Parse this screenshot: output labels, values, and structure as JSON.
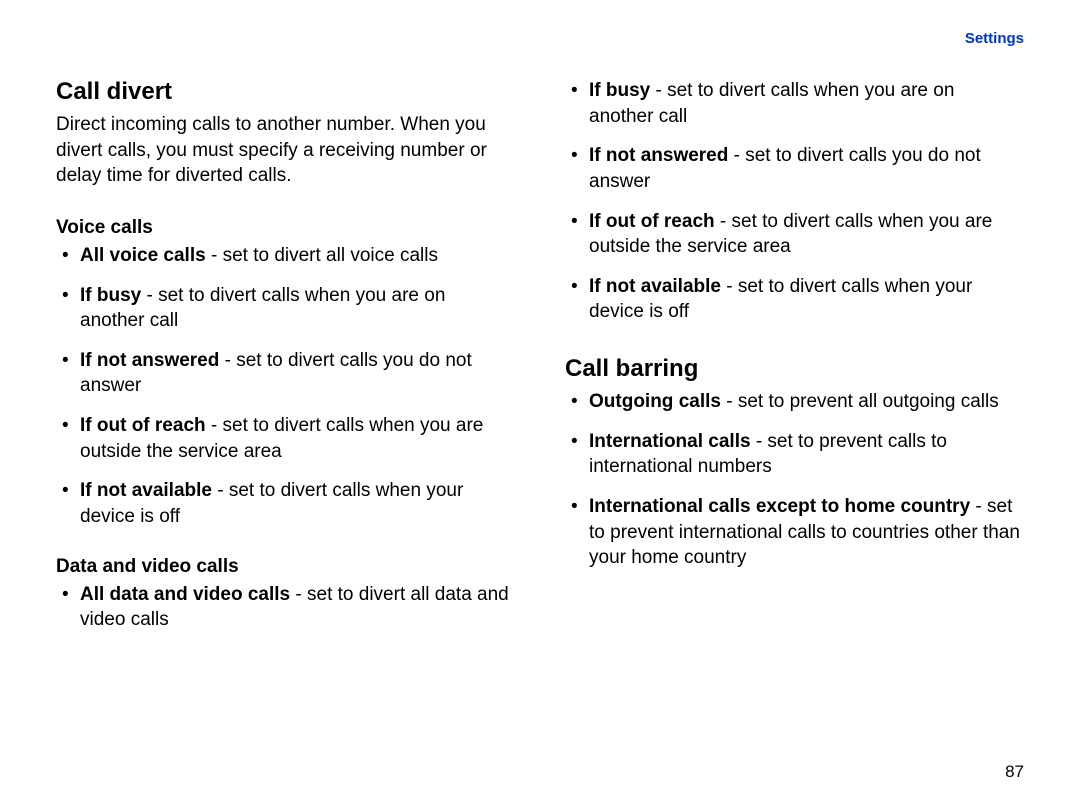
{
  "header_link": "Settings",
  "page_number": "87",
  "left": {
    "h_call_divert": "Call divert",
    "intro": "Direct incoming calls to another number. When you divert calls, you must specify a receiving number or delay time for diverted calls.",
    "sub_voice": "Voice calls",
    "voice_items": [
      {
        "label": "All voice calls",
        "desc": " - set to divert all voice calls"
      },
      {
        "label": "If busy",
        "desc": " - set to divert calls when you are on another call"
      },
      {
        "label": "If not answered",
        "desc": " - set to divert calls you do not answer"
      },
      {
        "label": "If out of reach",
        "desc": " - set to divert calls when you are outside the service area"
      },
      {
        "label": "If not available",
        "desc": " - set to divert calls when your device is off"
      }
    ],
    "sub_data": "Data and video calls",
    "data_items": [
      {
        "label": "All data and video calls",
        "desc": " - set to divert all data and video calls"
      }
    ]
  },
  "right": {
    "cont_items": [
      {
        "label": "If busy",
        "desc": " - set to divert calls when you are on another call"
      },
      {
        "label": "If not answered",
        "desc": " - set to divert calls you do not answer"
      },
      {
        "label": "If out of reach",
        "desc": " - set to divert calls when you are outside the service area"
      },
      {
        "label": "If not available",
        "desc": " - set to divert calls when your device is off"
      }
    ],
    "h_call_barring": "Call barring",
    "barring_items": [
      {
        "label": "Outgoing calls",
        "desc": " - set to prevent all outgoing calls"
      },
      {
        "label": "International calls",
        "desc": " - set to prevent calls to international numbers"
      },
      {
        "label": "International calls except to home country",
        "desc": " - set to prevent international calls to countries other than your home country"
      }
    ]
  }
}
